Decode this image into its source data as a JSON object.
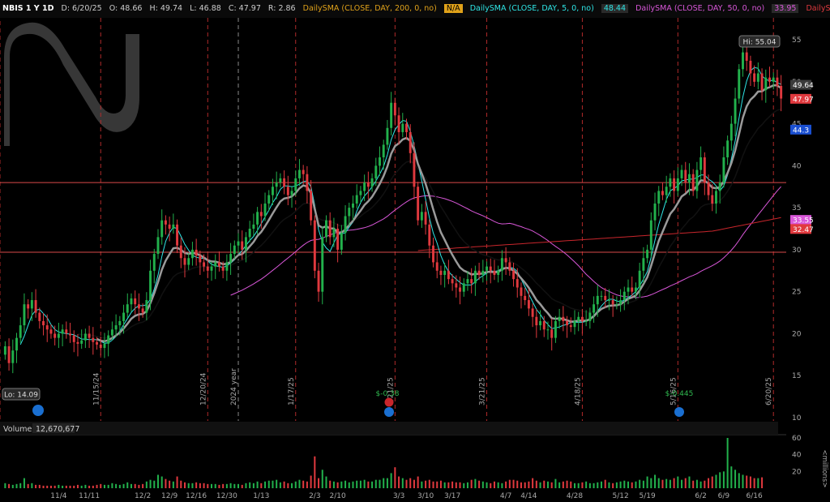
{
  "header": {
    "symbol": "NBIS 1 Y 1D",
    "date": "D: 6/20/25",
    "open": "O: 48.66",
    "high": "H: 49.74",
    "low": "L: 46.88",
    "close": "C: 47.97",
    "range": "R: 2.86",
    "sma200_label": "DailySMA (CLOSE, DAY, 200, 0, no)",
    "sma200_value": "N/A",
    "sma5_label": "DailySMA (CLOSE, DAY, 5, 0, no)",
    "sma5_value": "48.44",
    "sma50_label": "DailySMA (CLOSE, DAY, 50, 0, no)",
    "sma50_value": "33.95",
    "sma_red_label": "DailySMA (CLOSE, DA"
  },
  "colors": {
    "up": "#22b14c",
    "down": "#e0393e",
    "sma5": "#2ee6e6",
    "sma_gray": "#9a9a9a",
    "sma_black": "#111111",
    "sma50": "#d957d9",
    "sma200": "#c8262c",
    "sma200_hdr": "#e0a21a",
    "grid_red": "#b02a2a",
    "hline": "#d94a4a"
  },
  "logo": "logo-mark",
  "price_axis": {
    "ticks": [
      "55",
      "50",
      "45",
      "40",
      "35",
      "30",
      "25",
      "20",
      "15",
      "10"
    ],
    "tags": {
      "current": "47.97",
      "sma5": "49.64",
      "blue": "44.3",
      "sma50": "33.55",
      "sma200": "32.47"
    }
  },
  "annotations": {
    "hi": "Hi: 55.04",
    "lo": "Lo: 14.09",
    "event1": "$-0.38",
    "event2": "$-0.445",
    "year_label": "2024 year",
    "date_markers": [
      "11/15/24",
      "12/20/24",
      "1/17/25",
      "2/21/25",
      "3/21/25",
      "4/18/25",
      "5/16/25",
      "6/20/25"
    ]
  },
  "volume": {
    "title": "Volume",
    "value": "12,670,677",
    "axis_ticks": [
      "60",
      "40",
      "20"
    ],
    "unit": "<millions>"
  },
  "x_axis": {
    "labels": [
      "11/4",
      "11/11",
      "12/2",
      "12/9",
      "12/16",
      "12/30",
      "1/13",
      "2/3",
      "2/10",
      "3/3",
      "3/10",
      "3/17",
      "4/7",
      "4/14",
      "4/28",
      "5/12",
      "5/19",
      "6/2",
      "6/9",
      "6/16"
    ]
  },
  "chart_data": {
    "type": "candlestick",
    "title": "NBIS 1 Y 1D",
    "y_range": [
      10,
      58
    ],
    "volume_range_millions": [
      0,
      60
    ],
    "levels": [
      38,
      29.7
    ],
    "date_markers": [
      {
        "label": "11/15/24",
        "x_index": 25
      },
      {
        "label": "12/20/24",
        "x_index": 53
      },
      {
        "label": "2024 year",
        "x_index": 61
      },
      {
        "label": "1/17/25",
        "x_index": 76
      },
      {
        "label": "2/21/25",
        "x_index": 102
      },
      {
        "label": "3/21/25",
        "x_index": 126
      },
      {
        "label": "4/18/25",
        "x_index": 151
      },
      {
        "label": "5/16/25",
        "x_index": 176
      },
      {
        "label": "6/20/25",
        "x_index": 201
      }
    ],
    "close": [
      18.5,
      16.5,
      18.0,
      19.5,
      21.0,
      23.5,
      23.0,
      24.0,
      22.5,
      21.5,
      21.0,
      20.5,
      20.0,
      19.5,
      20.0,
      20.5,
      20.0,
      19.8,
      19.0,
      18.8,
      19.2,
      20.0,
      19.5,
      19.0,
      18.7,
      18.3,
      18.8,
      19.8,
      20.5,
      21.0,
      21.5,
      22.5,
      23.5,
      24.2,
      23.5,
      23.0,
      22.5,
      24.0,
      27.5,
      29.5,
      31.5,
      33.5,
      33.0,
      32.5,
      33.0,
      30.5,
      29.0,
      28.2,
      29.0,
      30.0,
      29.3,
      28.5,
      28.0,
      27.5,
      28.0,
      28.5,
      28.0,
      27.5,
      28.5,
      29.5,
      30.5,
      31.0,
      30.0,
      31.5,
      32.5,
      33.0,
      34.5,
      34.0,
      35.5,
      36.5,
      37.5,
      38.0,
      38.5,
      37.5,
      36.5,
      37.0,
      38.5,
      39.5,
      39.0,
      37.0,
      33.5,
      27.5,
      25.0,
      31.5,
      33.5,
      31.5,
      32.5,
      30.0,
      32.0,
      34.0,
      35.0,
      35.5,
      36.5,
      37.0,
      38.0,
      37.5,
      38.5,
      40.0,
      41.0,
      42.5,
      44.5,
      47.5,
      46.0,
      44.0,
      45.0,
      44.0,
      41.5,
      37.5,
      33.5,
      34.5,
      33.0,
      30.5,
      28.5,
      27.5,
      27.0,
      27.5,
      26.5,
      26.0,
      25.5,
      25.0,
      26.0,
      26.5,
      26.0,
      27.5,
      27.0,
      27.5,
      28.0,
      27.5,
      27.0,
      27.5,
      29.0,
      28.5,
      27.5,
      26.5,
      25.5,
      24.5,
      24.0,
      23.0,
      22.0,
      21.0,
      21.5,
      20.5,
      20.5,
      19.5,
      21.5,
      22.0,
      21.5,
      21.0,
      20.8,
      21.5,
      22.0,
      21.5,
      21.5,
      22.5,
      23.5,
      24.5,
      24.5,
      24.0,
      24.0,
      23.5,
      23.5,
      24.0,
      25.0,
      25.5,
      25.0,
      25.5,
      27.5,
      29.0,
      30.0,
      33.5,
      35.5,
      37.0,
      36.5,
      37.5,
      38.5,
      37.0,
      38.5,
      39.5,
      38.0,
      39.0,
      37.0,
      39.5,
      41.0,
      38.0,
      36.5,
      35.5,
      37.0,
      38.0,
      41.0,
      43.0,
      45.0,
      48.0,
      51.5,
      53.5,
      52.5,
      51.0,
      50.0,
      51.0,
      49.0,
      50.5,
      50.0,
      50.5,
      49.5,
      48.0
    ],
    "open": [
      17.5,
      18.5,
      16.5,
      18.0,
      19.5,
      21.0,
      23.5,
      23.0,
      24.0,
      22.5,
      21.5,
      21.0,
      20.5,
      20.0,
      19.5,
      20.0,
      20.5,
      20.0,
      19.8,
      19.0,
      18.8,
      19.2,
      20.0,
      19.5,
      19.0,
      18.7,
      18.3,
      18.8,
      19.8,
      20.5,
      21.0,
      21.5,
      22.5,
      23.5,
      24.2,
      23.5,
      23.0,
      22.5,
      24.0,
      27.5,
      29.5,
      31.5,
      33.5,
      33.0,
      32.5,
      33.0,
      30.5,
      29.0,
      28.2,
      29.0,
      30.0,
      29.3,
      28.5,
      28.0,
      27.5,
      28.0,
      28.5,
      28.0,
      27.5,
      28.5,
      29.5,
      30.5,
      31.0,
      30.0,
      31.5,
      32.5,
      33.0,
      34.5,
      34.0,
      35.5,
      36.5,
      37.5,
      38.0,
      38.5,
      37.5,
      36.5,
      37.0,
      38.5,
      39.5,
      39.0,
      37.0,
      33.5,
      27.5,
      25.0,
      31.5,
      33.5,
      31.5,
      32.5,
      30.0,
      32.0,
      34.0,
      35.0,
      35.5,
      36.5,
      37.0,
      38.0,
      37.5,
      38.5,
      40.0,
      41.0,
      42.5,
      44.5,
      47.5,
      46.0,
      44.0,
      45.0,
      44.0,
      41.5,
      37.5,
      33.5,
      34.5,
      33.0,
      30.5,
      28.5,
      27.5,
      27.0,
      27.5,
      26.5,
      26.0,
      25.5,
      25.0,
      26.0,
      26.5,
      26.0,
      27.5,
      27.0,
      27.5,
      28.0,
      27.5,
      27.0,
      27.5,
      29.0,
      28.5,
      27.5,
      26.5,
      25.5,
      24.5,
      24.0,
      23.0,
      22.0,
      21.0,
      21.5,
      20.5,
      20.5,
      19.5,
      21.5,
      22.0,
      21.5,
      21.0,
      20.8,
      21.5,
      22.0,
      21.5,
      21.5,
      22.5,
      23.5,
      24.5,
      24.5,
      24.0,
      24.0,
      23.5,
      23.5,
      24.0,
      25.0,
      25.5,
      25.0,
      25.5,
      27.5,
      29.0,
      30.0,
      33.5,
      35.5,
      37.0,
      36.5,
      37.5,
      38.5,
      37.0,
      38.5,
      39.5,
      38.0,
      39.0,
      37.0,
      39.5,
      41.0,
      38.0,
      36.5,
      35.5,
      37.0,
      38.0,
      41.0,
      43.0,
      45.0,
      48.0,
      51.5,
      53.5,
      52.5,
      51.0,
      50.0,
      51.0,
      49.0,
      50.5,
      50.0,
      50.5,
      49.5
    ],
    "volume_millions": [
      6,
      5,
      4,
      5,
      6,
      12,
      5,
      6,
      4,
      4,
      3,
      3,
      3,
      3,
      4,
      3,
      3,
      3,
      3,
      4,
      3,
      4,
      3,
      3,
      4,
      5,
      4,
      4,
      6,
      5,
      4,
      5,
      7,
      5,
      5,
      4,
      5,
      8,
      10,
      9,
      16,
      14,
      11,
      9,
      8,
      14,
      9,
      7,
      6,
      6,
      7,
      6,
      6,
      5,
      5,
      5,
      4,
      5,
      5,
      6,
      5,
      5,
      4,
      6,
      7,
      6,
      8,
      6,
      8,
      9,
      9,
      10,
      7,
      8,
      6,
      6,
      8,
      10,
      9,
      8,
      15,
      38,
      12,
      22,
      14,
      9,
      8,
      7,
      8,
      9,
      7,
      8,
      9,
      9,
      10,
      8,
      8,
      10,
      10,
      12,
      12,
      18,
      25,
      14,
      12,
      10,
      12,
      10,
      14,
      8,
      9,
      10,
      8,
      8,
      9,
      7,
      7,
      8,
      7,
      7,
      6,
      7,
      10,
      11,
      9,
      8,
      7,
      6,
      8,
      7,
      6,
      8,
      10,
      10,
      9,
      7,
      7,
      8,
      12,
      9,
      7,
      9,
      8,
      7,
      11,
      7,
      8,
      9,
      8,
      6,
      6,
      7,
      8,
      6,
      6,
      7,
      8,
      10,
      7,
      6,
      7,
      8,
      9,
      8,
      7,
      8,
      10,
      9,
      14,
      12,
      16,
      12,
      10,
      11,
      10,
      12,
      14,
      10,
      12,
      14,
      9,
      10,
      8,
      9,
      12,
      14,
      16,
      19,
      20,
      60,
      26,
      22,
      18,
      16,
      15,
      14,
      12,
      12,
      13
    ]
  }
}
